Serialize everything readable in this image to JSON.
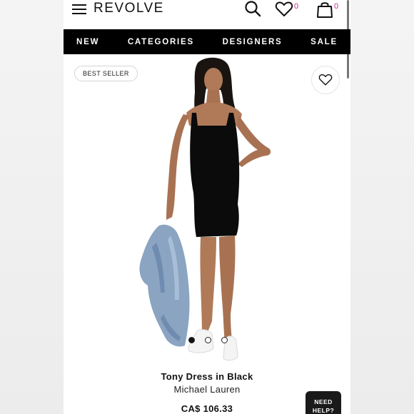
{
  "header": {
    "logo": "REVOLVE",
    "wishlist_count": "0",
    "bag_count": "0"
  },
  "nav": {
    "items": [
      "NEW",
      "CATEGORIES",
      "DESIGNERS",
      "SALE"
    ]
  },
  "product": {
    "badge": "BEST SELLER",
    "name": "Tony Dress in Black",
    "brand": "Michael Lauren",
    "price": "CA$ 106.33",
    "image_count": 3,
    "active_image": 1
  },
  "help_button": {
    "line1": "NEED",
    "line2": "HELP?"
  },
  "colors": {
    "nav_bg": "#000000",
    "count_accent": "#c32a8f"
  },
  "icons": [
    "menu-icon",
    "search-icon",
    "heart-icon",
    "shopping-bag-icon"
  ]
}
